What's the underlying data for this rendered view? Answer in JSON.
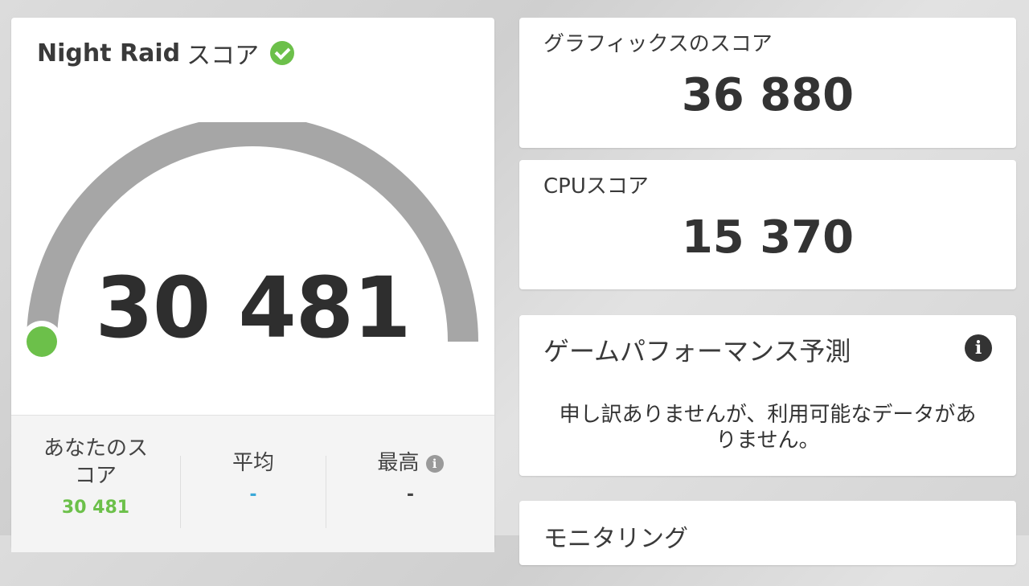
{
  "main": {
    "title_en": "Night Raid",
    "title_ja": "スコア",
    "score": "30 481",
    "gauge_fraction": 0.0
  },
  "stats": {
    "your_score_label": "あなたのスコア",
    "your_score_value": "30 481",
    "average_label": "平均",
    "average_value": "-",
    "best_label": "最高",
    "best_value": "-"
  },
  "graphics": {
    "label": "グラフィックスのスコア",
    "value": "36 880"
  },
  "cpu": {
    "label": "CPUスコア",
    "value": "15 370"
  },
  "performance": {
    "title": "ゲームパフォーマンス予測",
    "message": "申し訳ありませんが、利用可能なデータがありません。"
  },
  "monitoring": {
    "title": "モニタリング"
  },
  "colors": {
    "accent_green": "#6cc04a",
    "average_blue": "#3aa8d8",
    "gauge_gray": "#a6a6a6"
  },
  "icons": {
    "check": "check-circle-icon",
    "info_small": "info-icon",
    "info_large": "info-icon"
  }
}
